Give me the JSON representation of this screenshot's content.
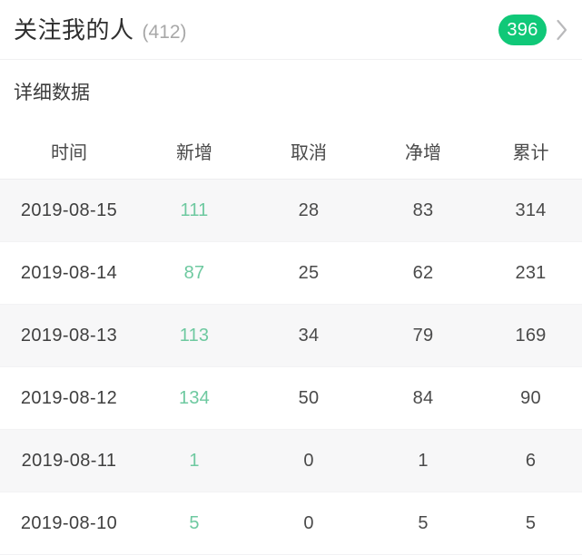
{
  "header": {
    "title": "关注我的人",
    "count_label": "(412)",
    "badge_value": "396",
    "chevron_icon": "chevron-right-icon",
    "badge_color": "#10c878",
    "count_color": "#a8a8a8"
  },
  "section": {
    "title": "详细数据"
  },
  "table": {
    "columns": [
      "时间",
      "新增",
      "取消",
      "净增",
      "累计"
    ],
    "added_color": "#6ec9a0",
    "rows": [
      {
        "date": "2019-08-15",
        "added": "111",
        "cancel": "28",
        "net": "83",
        "total": "314"
      },
      {
        "date": "2019-08-14",
        "added": "87",
        "cancel": "25",
        "net": "62",
        "total": "231"
      },
      {
        "date": "2019-08-13",
        "added": "113",
        "cancel": "34",
        "net": "79",
        "total": "169"
      },
      {
        "date": "2019-08-12",
        "added": "134",
        "cancel": "50",
        "net": "84",
        "total": "90"
      },
      {
        "date": "2019-08-11",
        "added": "1",
        "cancel": "0",
        "net": "1",
        "total": "6"
      },
      {
        "date": "2019-08-10",
        "added": "5",
        "cancel": "0",
        "net": "5",
        "total": "5"
      }
    ]
  },
  "chart_data": {
    "type": "table",
    "title": "详细数据",
    "columns": [
      "时间",
      "新增",
      "取消",
      "净增",
      "累计"
    ],
    "rows": [
      [
        "2019-08-15",
        111,
        28,
        83,
        314
      ],
      [
        "2019-08-14",
        87,
        25,
        62,
        231
      ],
      [
        "2019-08-13",
        113,
        34,
        79,
        169
      ],
      [
        "2019-08-12",
        134,
        50,
        84,
        90
      ],
      [
        "2019-08-11",
        1,
        0,
        1,
        6
      ],
      [
        "2019-08-10",
        5,
        0,
        5,
        5
      ]
    ]
  }
}
